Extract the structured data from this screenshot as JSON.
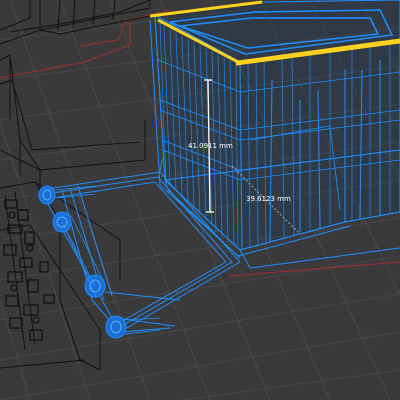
{
  "viewport": {
    "background_color": "#3a3a3a",
    "grid_color": "#4a4a4a",
    "axis_color": "#9b2f2f",
    "wire_color": "#1e90ff",
    "selection_color": "#ffd21f",
    "reference_wire_color": "#0e0e0e"
  },
  "measurements": {
    "height": {
      "label": "41.0911 mm",
      "value": 41.0911,
      "unit": "mm"
    },
    "depth": {
      "label": "39.6123 mm",
      "value": 39.6123,
      "unit": "mm"
    }
  }
}
